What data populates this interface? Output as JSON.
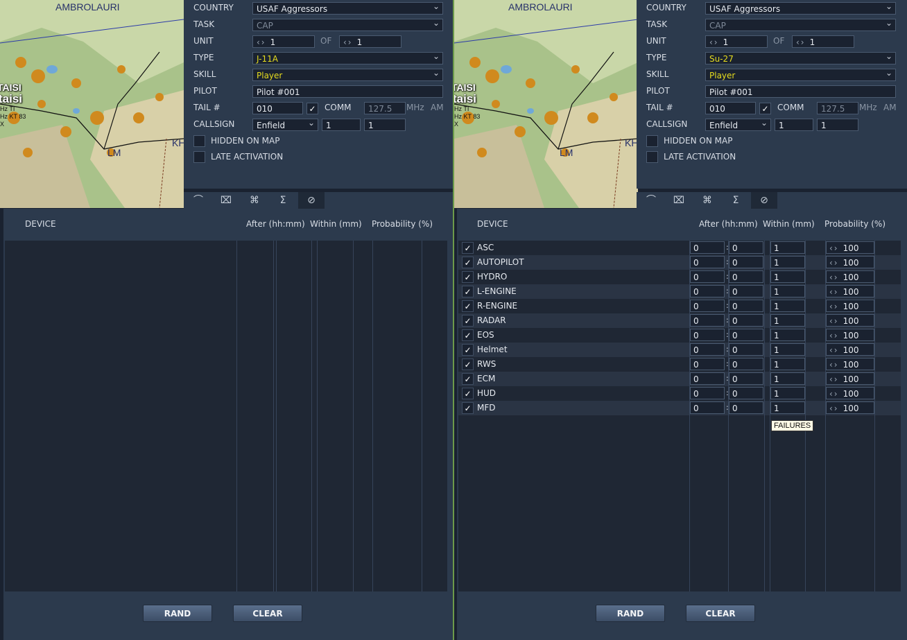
{
  "colors": {
    "panel": "#2c3a4d",
    "dark": "#1a2230",
    "accent_yellow": "#e6dc1e"
  },
  "map": {
    "label_top": "AMBROLAURI",
    "label_city_upper": "TAISI",
    "label_city": "taisi",
    "label_hz": "Hz TI",
    "label_kt": "Hz KT 83",
    "label_x": "X",
    "label_lm": "LM",
    "label_kh": "KH"
  },
  "labels": {
    "country": "COUNTRY",
    "task": "TASK",
    "unit": "UNIT",
    "of": "OF",
    "type": "TYPE",
    "skill": "SKILL",
    "pilot": "PILOT",
    "tail": "TAIL #",
    "comm": "COMM",
    "mhz": "MHz",
    "am": "AM",
    "callsign": "CALLSIGN",
    "hidden": "HIDDEN ON MAP",
    "late": "LATE ACTIVATION",
    "col_device": "DEVICE",
    "col_after": "After (hh:mm)",
    "col_within": "Within (mm)",
    "col_prob": "Probability (%)",
    "rand": "RAND",
    "clear": "CLEAR"
  },
  "tabs": [
    {
      "icon": "route-icon",
      "glyph": "⌒"
    },
    {
      "icon": "payload-icon",
      "glyph": "⌧"
    },
    {
      "icon": "aircraft-icon",
      "glyph": "⌘"
    },
    {
      "icon": "summary-icon",
      "glyph": "Σ"
    },
    {
      "icon": "failures-icon",
      "glyph": "⊘"
    }
  ],
  "tooltip": "FAILURES",
  "left": {
    "country": "USAF Aggressors",
    "task": "CAP",
    "unit": "1",
    "of": "1",
    "type": "J-11A",
    "skill": "Player",
    "pilot": "Pilot #001",
    "tail": "010",
    "comm_freq": "127.5",
    "callsign": "Enfield",
    "callsign_n1": "1",
    "callsign_n2": "1",
    "comm_checked": "✓"
  },
  "right": {
    "country": "USAF Aggressors",
    "task": "CAP",
    "unit": "1",
    "of": "1",
    "type": "Su-27",
    "skill": "Player",
    "pilot": "Pilot #001",
    "tail": "010",
    "comm_freq": "127.5",
    "callsign": "Enfield",
    "callsign_n1": "1",
    "callsign_n2": "1",
    "comm_checked": "✓",
    "failures": [
      {
        "name": "ASC",
        "h": "0",
        "m": "0",
        "within": "1",
        "prob": "100"
      },
      {
        "name": "AUTOPILOT",
        "h": "0",
        "m": "0",
        "within": "1",
        "prob": "100"
      },
      {
        "name": "HYDRO",
        "h": "0",
        "m": "0",
        "within": "1",
        "prob": "100"
      },
      {
        "name": "L-ENGINE",
        "h": "0",
        "m": "0",
        "within": "1",
        "prob": "100"
      },
      {
        "name": "R-ENGINE",
        "h": "0",
        "m": "0",
        "within": "1",
        "prob": "100"
      },
      {
        "name": "RADAR",
        "h": "0",
        "m": "0",
        "within": "1",
        "prob": "100"
      },
      {
        "name": "EOS",
        "h": "0",
        "m": "0",
        "within": "1",
        "prob": "100"
      },
      {
        "name": "Helmet",
        "h": "0",
        "m": "0",
        "within": "1",
        "prob": "100"
      },
      {
        "name": "RWS",
        "h": "0",
        "m": "0",
        "within": "1",
        "prob": "100"
      },
      {
        "name": "ECM",
        "h": "0",
        "m": "0",
        "within": "1",
        "prob": "100"
      },
      {
        "name": "HUD",
        "h": "0",
        "m": "0",
        "within": "1",
        "prob": "100"
      },
      {
        "name": "MFD",
        "h": "0",
        "m": "0",
        "within": "1",
        "prob": "100"
      }
    ]
  }
}
